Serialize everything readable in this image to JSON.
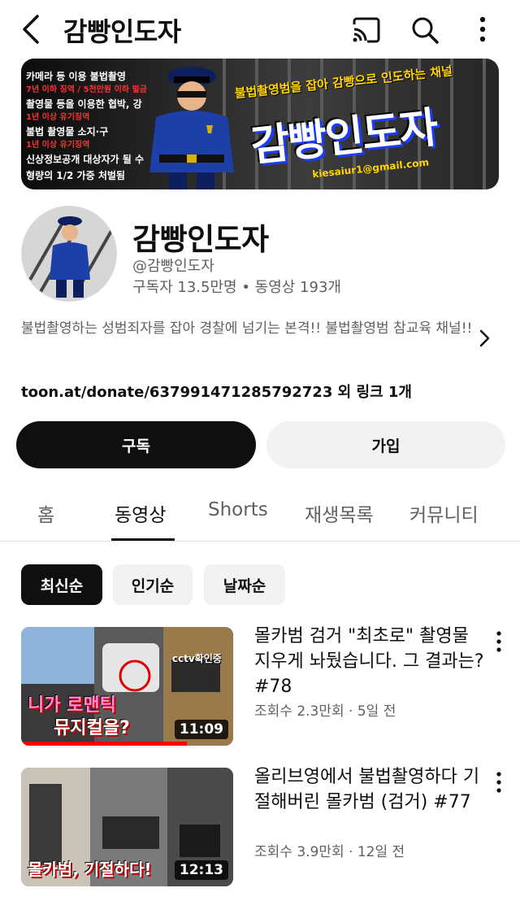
{
  "header": {
    "title": "감빵인도자",
    "icons": [
      "back-arrow-icon",
      "cast-icon",
      "search-icon",
      "more-vert-icon"
    ]
  },
  "banner": {
    "rules": [
      "카메라 등 이용 불법촬영",
      "7년 이하 징역 / 5천만원 이하 벌금",
      "촬영물 등을 이용한 협박, 강",
      "1년 이상 유기징역",
      "불법 촬영물 소지·구",
      "1년 이상 유기징역",
      "신상정보공개 대상자가 될 수",
      "형량의 1/2 가중 처벌됨"
    ],
    "slogan": "불법촬영범을 잡아 감빵으로 인도하는 채널",
    "big_title": "감빵인도자",
    "email": "kiesaiur1@gmail.com"
  },
  "channel": {
    "name": "감빵인도자",
    "handle": "@감빵인도자",
    "stats": "구독자 13.5만명 • 동영상 193개",
    "description": "불법촬영하는 성범죄자를 잡아 경찰에 넘기는 본격!! 불법촬영범 참교육 채널!!",
    "link": "toon.at/donate/637991471285792723 외 링크 1개"
  },
  "actions": {
    "subscribe_label": "구독",
    "join_label": "가입"
  },
  "tabs": [
    {
      "label": "홈",
      "active": false
    },
    {
      "label": "동영상",
      "active": true
    },
    {
      "label": "Shorts",
      "active": false
    },
    {
      "label": "재생목록",
      "active": false
    },
    {
      "label": "커뮤니티",
      "active": false
    }
  ],
  "filters": [
    {
      "label": "최신순",
      "selected": true
    },
    {
      "label": "인기순",
      "selected": false
    },
    {
      "label": "날짜순",
      "selected": false
    }
  ],
  "videos": [
    {
      "title": "몰카범 검거 \"최초로\" 촬영물 지우게 놔뒀습니다. 그 결과는? #78",
      "meta": "조회수 2.3만회 · 5일 전",
      "duration": "11:09",
      "thumb_caption_1": "니가 로맨틱",
      "thumb_caption_2": "뮤지컬을?",
      "thumb_tag": "cctv확인중",
      "watched_fraction": 0.78
    },
    {
      "title": "올리브영에서 불법촬영하다 기절해버린 몰카범 (검거) #77",
      "meta": "조회수 3.9만회 · 12일 전",
      "duration": "12:13",
      "thumb_caption_1": "몰카범, 기절하다!",
      "watched_fraction": 0
    }
  ],
  "colors": {
    "text_primary": "#0f0f0f",
    "text_secondary": "#606060",
    "chip_bg": "#f2f2f2",
    "progress_red": "#ff0000",
    "banner_yellow": "#ffd400"
  }
}
